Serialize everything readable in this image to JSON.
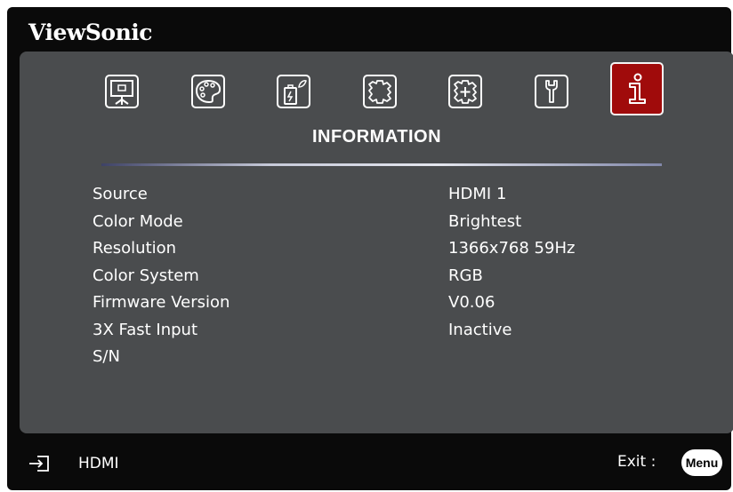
{
  "brand": "ViewSonic",
  "menu": {
    "title": "INFORMATION",
    "icons": [
      "display-icon",
      "picture-palette-icon",
      "power-management-icon",
      "basic-settings-icon",
      "advanced-settings-icon",
      "system-wrench-icon",
      "information-icon"
    ],
    "active_icon": "information-icon"
  },
  "info_rows": [
    {
      "label": "Source",
      "value": "HDMI 1"
    },
    {
      "label": "Color Mode",
      "value": "Brightest"
    },
    {
      "label": "Resolution",
      "value": "1366x768 59Hz"
    },
    {
      "label": "Color System",
      "value": "RGB"
    },
    {
      "label": "Firmware Version",
      "value": "V0.06"
    },
    {
      "label": "3X Fast Input",
      "value": "Inactive"
    },
    {
      "label": "S/N",
      "value": ""
    }
  ],
  "footer": {
    "source_label": "HDMI",
    "exit_label": "Exit :",
    "menu_button": "Menu"
  },
  "colors": {
    "panel": "#4a4c4e",
    "active_tab": "#a00b0b",
    "background": "#0a0a0a"
  }
}
